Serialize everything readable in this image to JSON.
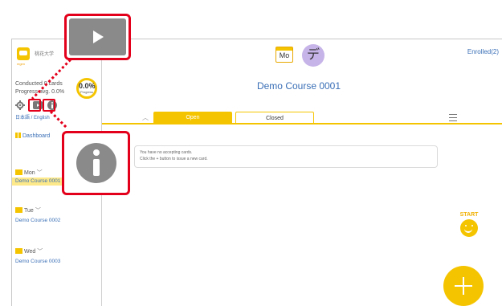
{
  "sidebar": {
    "logo_text": "mgen",
    "school_name": "桃花大学",
    "conducted": "Conducted 0 cards",
    "progress_avg": "Progress avg. 0.0%",
    "progress_value": "0.0%",
    "progress_label": "Progress",
    "language": "日本語 / English",
    "dashboard": "Dashboard",
    "days": [
      {
        "label": "Mon",
        "course": "Demo Course 0001"
      },
      {
        "label": "Tue",
        "course": "Demo Course 0002"
      },
      {
        "label": "Wed",
        "course": "Demo Course 0003"
      }
    ]
  },
  "header": {
    "day_icon_text": "Mo",
    "avatar_char": "デ",
    "enrolled": "Enrolled(2)",
    "course_title": "Demo Course 0001"
  },
  "tabs": {
    "open": "Open",
    "closed": "Closed"
  },
  "notice": {
    "line1": "You have no accepting cards.",
    "line2": "Click the + button to issue a new card."
  },
  "start_label": "START",
  "colors": {
    "accent": "#f5c400",
    "link": "#3a6fb6",
    "callout": "#e3001b"
  }
}
